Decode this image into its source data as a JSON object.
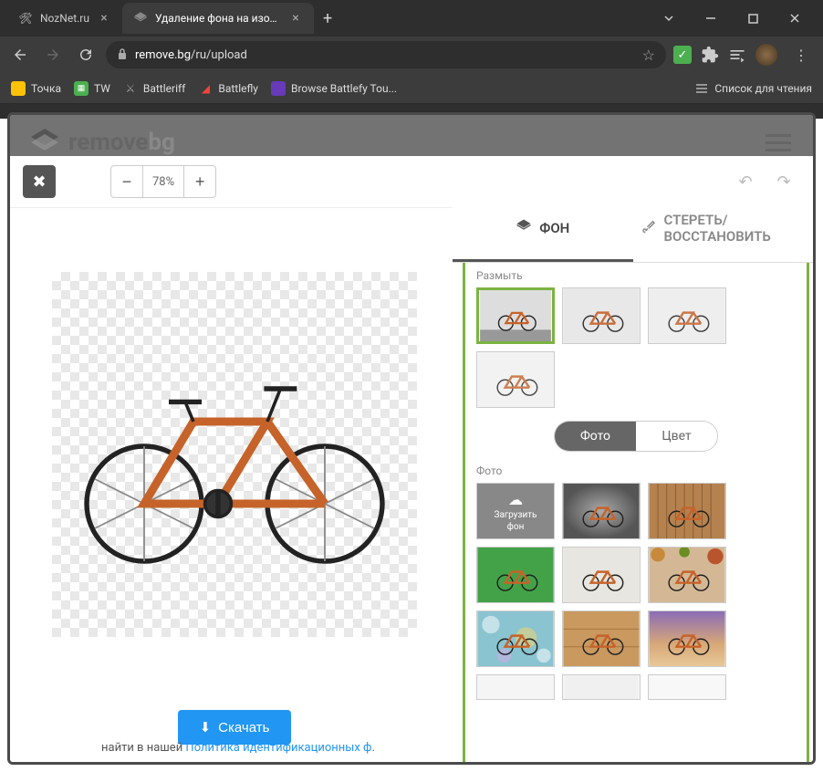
{
  "browser": {
    "tabs": [
      {
        "title": "NozNet.ru",
        "icon": "tools"
      },
      {
        "title": "Удаление фона на изображени",
        "icon": "layers",
        "active": true
      }
    ],
    "url_domain": "remove.bg",
    "url_path": "/ru/upload",
    "bookmarks": [
      {
        "label": "Точка",
        "color": "#ffc107"
      },
      {
        "label": "TW",
        "color": "#4caf50"
      },
      {
        "label": "Battleriff",
        "color": "#999"
      },
      {
        "label": "Battlefly",
        "color": "#f44336"
      },
      {
        "label": "Browse Battlefy Tou...",
        "color": "#673ab7"
      }
    ],
    "reading_list": "Список для чтения"
  },
  "brand": {
    "name_bold": "remove",
    "name_light": "bg"
  },
  "editor": {
    "zoom": "78%",
    "tabs": {
      "background": "ФОН",
      "erase_restore": "СТЕРЕТЬ/ВОССТАНОВИТЬ"
    },
    "download": "Скачать"
  },
  "sidebar": {
    "blur_label": "Размыть",
    "toggle": {
      "photo": "Фото",
      "color": "Цвет"
    },
    "photo_label": "Фото",
    "upload_bg_line1": "Загрузить",
    "upload_bg_line2": "фон"
  },
  "footer": {
    "text_prefix": "найти в нашей ",
    "link": "Политика идентификационных ф",
    "text_suffix": "."
  }
}
